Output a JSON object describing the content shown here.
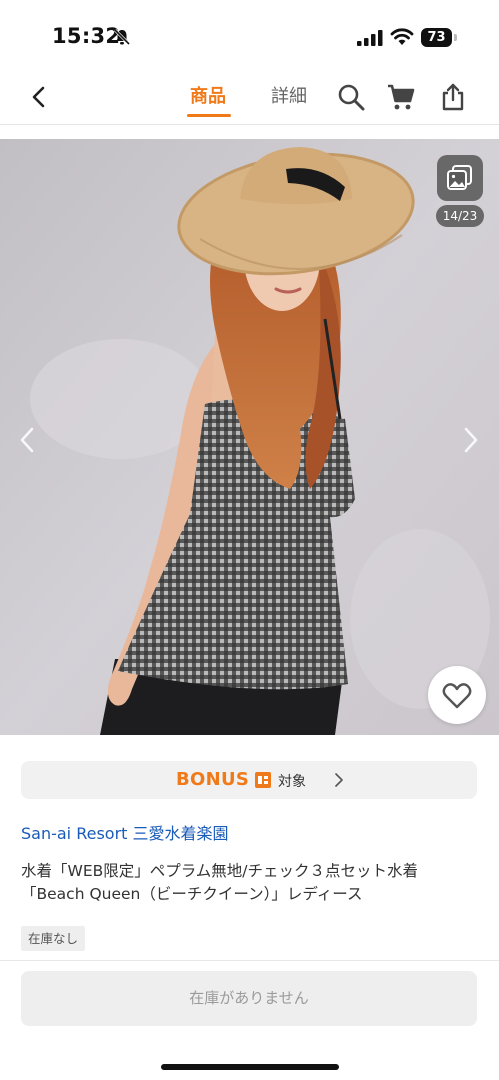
{
  "status_bar": {
    "time": "15:32",
    "battery": "73"
  },
  "nav": {
    "tabs": [
      {
        "label": "商品",
        "active": true
      },
      {
        "label": "詳細",
        "active": false
      }
    ],
    "accent_color": "#f07a1a"
  },
  "gallery": {
    "counter": "14/23",
    "image_description_icon": "gallery-stack-icon"
  },
  "bonus": {
    "logo_text": "BONUS",
    "target_label": "対象"
  },
  "product": {
    "shop_name": "San-ai Resort 三愛水着楽園",
    "title_line1": "水着「WEB限定」ペプラム無地/チェック３点セット水着",
    "title_line2": "「Beach Queen（ビーチクイーン）」レディース",
    "stock_tag": "在庫なし",
    "buy_button_label": "在庫がありません"
  }
}
